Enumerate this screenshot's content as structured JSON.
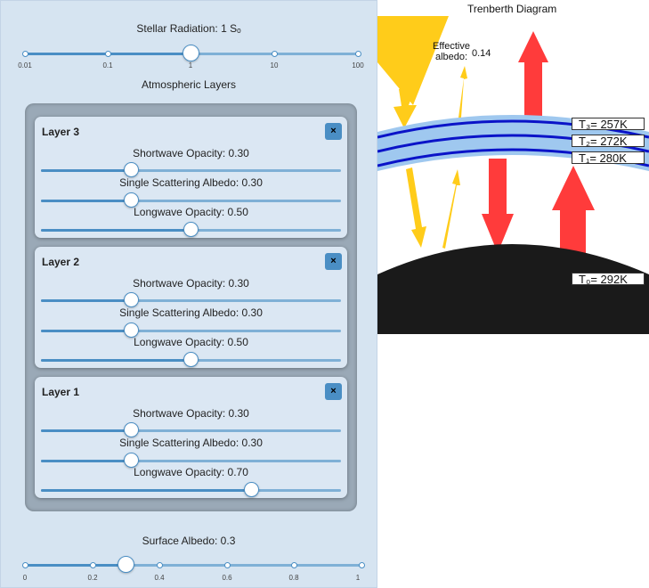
{
  "left_panel": {
    "stellar": {
      "label": "Stellar Radiation: 1 Sₒ",
      "ticks": [
        "0.01",
        "0.1",
        "1",
        "10",
        "100"
      ],
      "value_fraction": 0.5
    },
    "layers_heading": "Atmospheric Layers",
    "layers": [
      {
        "title": "Layer 3",
        "close": "×",
        "sw_label": "Shortwave Opacity: 0.30",
        "sw": 0.3,
        "ssa_label": "Single Scattering Albedo: 0.30",
        "ssa": 0.3,
        "lw_label": "Longwave Opacity: 0.50",
        "lw": 0.5
      },
      {
        "title": "Layer 2",
        "close": "×",
        "sw_label": "Shortwave Opacity: 0.30",
        "sw": 0.3,
        "ssa_label": "Single Scattering Albedo: 0.30",
        "ssa": 0.3,
        "lw_label": "Longwave Opacity: 0.50",
        "lw": 0.5
      },
      {
        "title": "Layer 1",
        "close": "×",
        "sw_label": "Shortwave Opacity: 0.30",
        "sw": 0.3,
        "ssa_label": "Single Scattering Albedo: 0.30",
        "ssa": 0.3,
        "lw_label": "Longwave Opacity: 0.70",
        "lw": 0.7
      }
    ],
    "surface": {
      "label": "Surface Albedo: 0.3",
      "ticks": [
        "0",
        "0.2",
        "0.4",
        "0.6",
        "0.8",
        "1"
      ],
      "value": 0.3
    }
  },
  "diagram": {
    "title": "Trenberth Diagram",
    "effective_label_1": "Effective",
    "effective_label_2": "albedo:",
    "effective_value": "0.14",
    "temps": [
      "T₃= 257K",
      "T₂= 272K",
      "T₁= 280K",
      "T₀= 292K"
    ],
    "colors": {
      "sun": "#ffcc1a",
      "ir": "#ff3b3b",
      "layer_light": "#9fc8ef",
      "layer_dark": "#0a13c8",
      "ground": "#1a1a1a"
    }
  }
}
